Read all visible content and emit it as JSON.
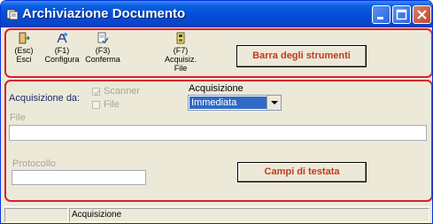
{
  "window": {
    "title": "Archiviazione Documento"
  },
  "toolbar": {
    "tools": [
      {
        "key": "(Esc)",
        "label": "Esci",
        "icon": "exit-door-icon"
      },
      {
        "key": "(F1)",
        "label": "Configura",
        "icon": "configure-icon"
      },
      {
        "key": "(F3)",
        "label": "Conferma",
        "icon": "confirm-icon"
      },
      {
        "key": "(F7)",
        "label": "Acquisiz.",
        "label2": "File",
        "icon": "acquire-file-icon"
      }
    ],
    "group_label": "Barra degli strumenti"
  },
  "acquisition": {
    "from_label": "Acquisizione da:",
    "scanner_label": "Scanner",
    "file_label": "File",
    "combo_caption": "Acquisizione",
    "combo_value": "Immediata"
  },
  "file_field": {
    "label": "File",
    "value": ""
  },
  "protocol_field": {
    "label": "Protocollo",
    "value": ""
  },
  "header_fields_label": "Campi di testata",
  "status": {
    "pane1": "",
    "pane2": "Acquisizione"
  },
  "colors": {
    "titlebar": "#0550d8",
    "group_border": "#d91f2f",
    "label_text": "#c23a1a",
    "selection": "#316ac5"
  }
}
